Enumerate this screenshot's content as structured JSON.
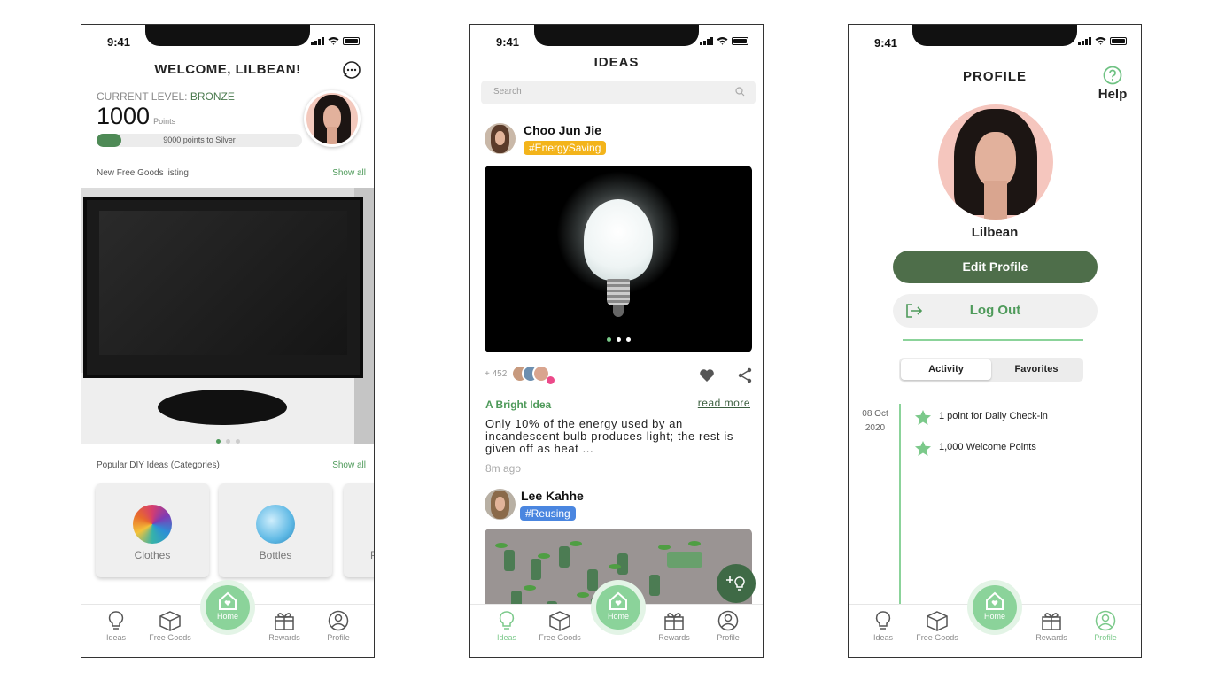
{
  "status": {
    "time": "9:41"
  },
  "home": {
    "title": "WELCOME, LILBEAN!",
    "level_label": "CURRENT LEVEL:",
    "level_value": "BRONZE",
    "points_value": "1000",
    "points_unit": "Points",
    "progress_text": "9000 points to Silver",
    "progress_fraction": 0.1,
    "listing_label": "New Free Goods listing",
    "show_all": "Show all",
    "diy_label": "Popular DIY Ideas (Categories)",
    "categories": [
      {
        "label": "Clothes"
      },
      {
        "label": "Bottles"
      },
      {
        "label": "P"
      }
    ]
  },
  "ideas": {
    "title": "IDEAS",
    "search_placeholder": "Search",
    "post1": {
      "author": "Choo Jun Jie",
      "tag": "#EnergySaving",
      "likes": "+ 452",
      "title": "A Bright Idea",
      "read_more": "read more",
      "body": "Only 10% of the energy used by an incandescent bulb produces light; the rest is given off as heat ...",
      "time": "8m ago"
    },
    "post2": {
      "author": "Lee Kahhe",
      "tag": "#Reusing"
    }
  },
  "profile": {
    "title": "PROFILE",
    "help": "Help",
    "name": "Lilbean",
    "edit_label": "Edit Profile",
    "logout_label": "Log Out",
    "tabs": [
      {
        "label": "Activity"
      },
      {
        "label": "Favorites"
      }
    ],
    "timeline_day": "08 Oct",
    "timeline_year": "2020",
    "activities": [
      {
        "text": "1 point for Daily Check-in"
      },
      {
        "text": "1,000 Welcome Points"
      }
    ]
  },
  "nav": {
    "ideas": "Ideas",
    "free_goods": "Free Goods",
    "home": "Home",
    "rewards": "Rewards",
    "profile": "Profile"
  },
  "colors": {
    "accent": "#8bd39a",
    "dark_green": "#4e6e4a",
    "text_green": "#4e9a5a"
  }
}
